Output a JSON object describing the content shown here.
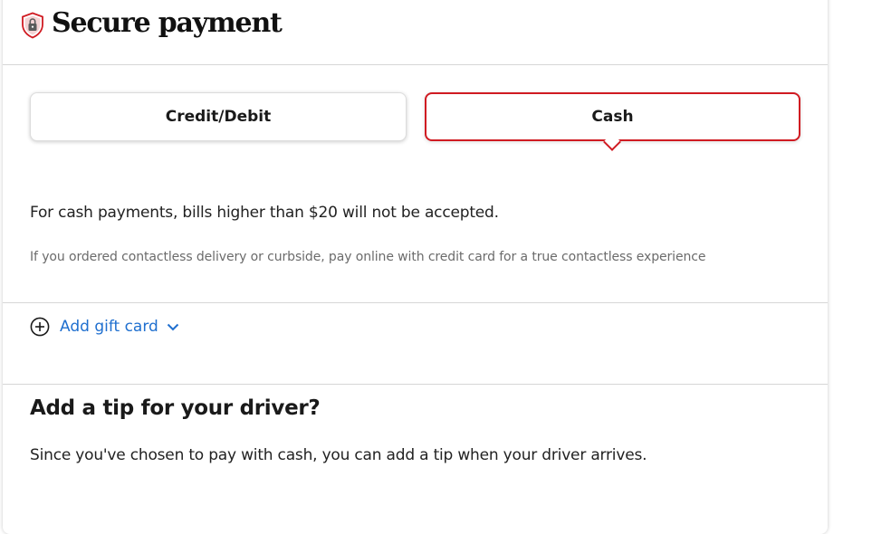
{
  "header": {
    "title": "Secure payment",
    "icon": "shield-lock-icon"
  },
  "payment_tabs": [
    {
      "label": "Credit/Debit",
      "selected": false
    },
    {
      "label": "Cash",
      "selected": true
    }
  ],
  "cash_section": {
    "note": "For cash payments, bills higher than $20 will not be accepted.",
    "contactless_note": "If you ordered contactless delivery or curbside, pay online with credit card for a true contactless experience"
  },
  "gift_card": {
    "label": "Add gift card",
    "icon": "plus-circle-icon",
    "chevron": "chevron-down-icon"
  },
  "tip": {
    "heading": "Add a tip for your driver?",
    "text": "Since you've chosen to pay with cash, you can add a tip when your driver arrives."
  },
  "colors": {
    "accent": "#d01b22",
    "link": "#1f6fcf"
  }
}
